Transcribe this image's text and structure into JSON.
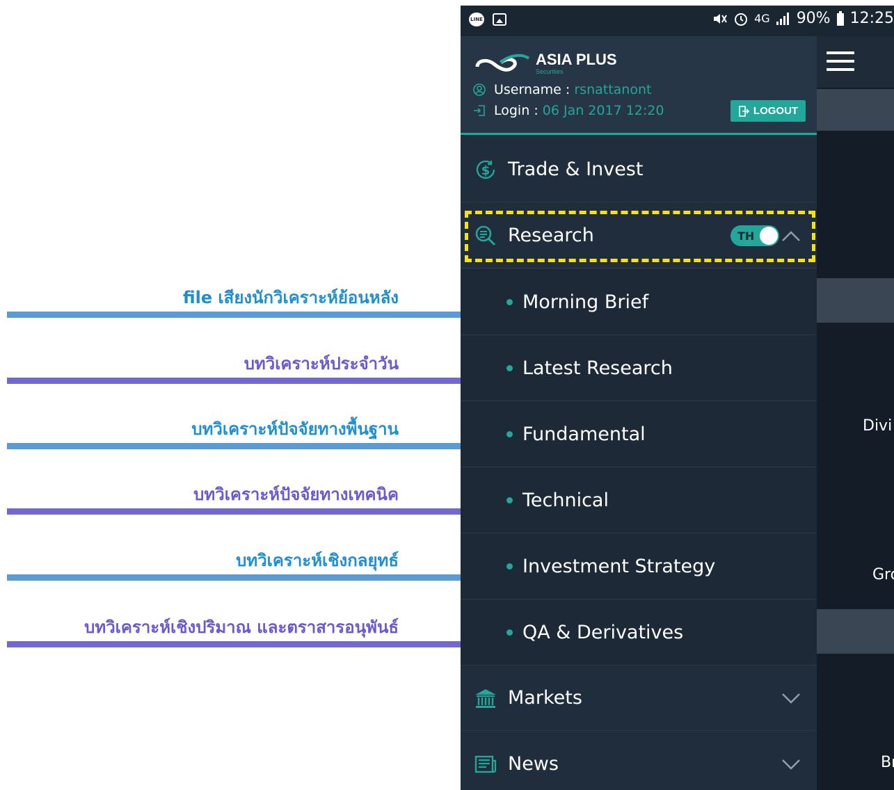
{
  "annotations": [
    {
      "label": "file เสียงนักวิเคราะห์ย้อนหลัง",
      "color": "#1e8fd0",
      "line_color": "#5b9bd5"
    },
    {
      "label": "บทวิเคราะห์ประจำวัน",
      "color": "#6a5acd",
      "line_color": "#7367d0"
    },
    {
      "label": "บทวิเคราะห์ปัจจัยทางพื้นฐาน",
      "color": "#1e8fd0",
      "line_color": "#5b9bd5"
    },
    {
      "label": "บทวิเคราะห์ปัจจัยทางเทคนิค",
      "color": "#6a5acd",
      "line_color": "#7367d0"
    },
    {
      "label": "บทวิเคราะห์เชิงกลยุทธ์",
      "color": "#1e8fd0",
      "line_color": "#5b9bd5"
    },
    {
      "label": "บทวิเคราะห์เชิงปริมาณ และตราสารอนุพันธ์",
      "color": "#6a5acd",
      "line_color": "#7367d0"
    }
  ],
  "statusbar": {
    "signal_label": "4G",
    "battery": "90%",
    "time": "12:25"
  },
  "drawer": {
    "logo": {
      "name": "ASIA PLUS",
      "sub": "Securities"
    },
    "username_label": "Username",
    "username_value": "rsnattanont",
    "login_label": "Login",
    "login_value": "06 Jan 2017 12:20",
    "separator": ":",
    "logout_label": "LOGOUT",
    "menu": {
      "trade": "Trade & Invest",
      "research": "Research",
      "research_toggle": "TH",
      "markets": "Markets",
      "news": "News"
    },
    "research_items": [
      "Morning Brief",
      "Latest Research",
      "Fundamental",
      "Technical",
      "Investment Strategy",
      "QA & Derivatives"
    ]
  },
  "content": {
    "fragments": [
      "Divi",
      "Gro",
      "Br"
    ]
  },
  "colors": {
    "accent": "#22a79a",
    "highlight": "#f5e20e"
  }
}
